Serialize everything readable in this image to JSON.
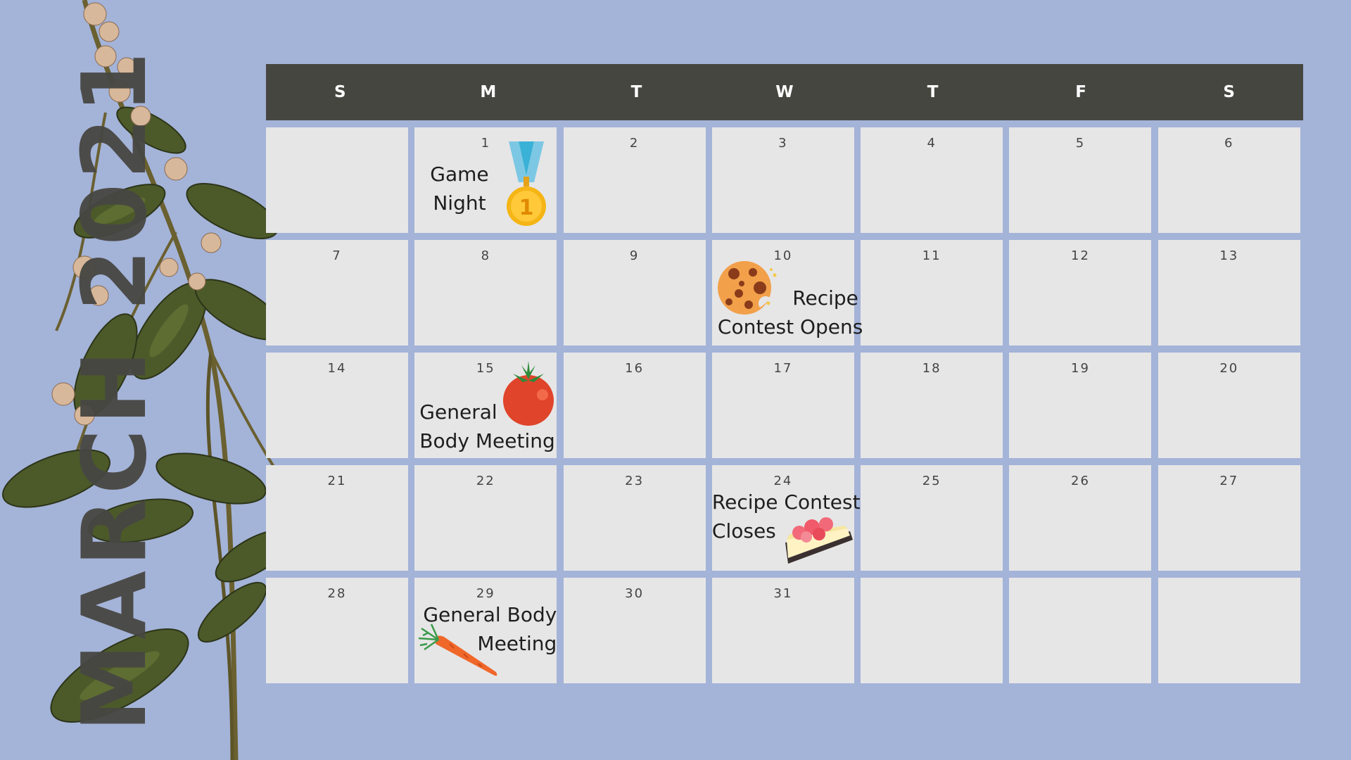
{
  "title": "MARCH 2021",
  "weekdays": [
    "S",
    "M",
    "T",
    "W",
    "T",
    "F",
    "S"
  ],
  "days": {
    "d1": "1",
    "d2": "2",
    "d3": "3",
    "d4": "4",
    "d5": "5",
    "d6": "6",
    "d7": "7",
    "d8": "8",
    "d9": "9",
    "d10": "10",
    "d11": "11",
    "d12": "12",
    "d13": "13",
    "d14": "14",
    "d15": "15",
    "d16": "16",
    "d17": "17",
    "d18": "18",
    "d19": "19",
    "d20": "20",
    "d21": "21",
    "d22": "22",
    "d23": "23",
    "d24": "24",
    "d25": "25",
    "d26": "26",
    "d27": "27",
    "d28": "28",
    "d29": "29",
    "d30": "30",
    "d31": "31"
  },
  "events": {
    "game_night": {
      "line1": "Game",
      "line2": "Night",
      "icon": "gold-medal-icon"
    },
    "recipe_opens": {
      "line1": "Recipe",
      "line2": "Contest Opens",
      "icon": "cookie-icon"
    },
    "gbm_15": {
      "line1": "General",
      "line2": "Body Meeting",
      "icon": "tomato-icon"
    },
    "recipe_closes": {
      "line1": "Recipe Contest",
      "line2": "Closes",
      "icon": "cake-slice-icon"
    },
    "gbm_29": {
      "line1": "General Body",
      "line2": "Meeting",
      "icon": "carrot-icon"
    }
  },
  "colors": {
    "background": "#a4b3d8",
    "header": "#464641",
    "cell": "#e6e6e6",
    "title": "#474743"
  },
  "decoration": "mint-plant-illustration"
}
